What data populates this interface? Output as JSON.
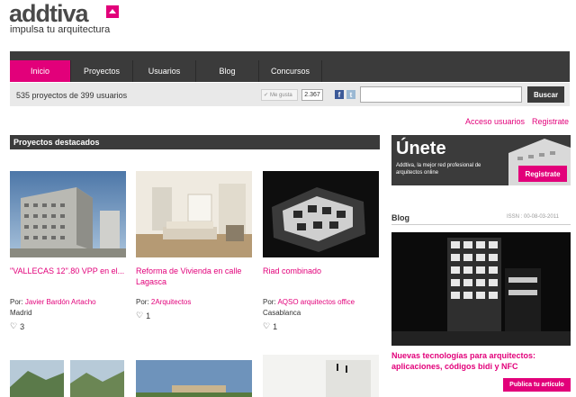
{
  "brand": {
    "name": "addtiva",
    "tagline": "impulsa tu arquitectura",
    "accent": "#e2007a",
    "dark": "#3b3b3b"
  },
  "nav": [
    {
      "label": "Inicio",
      "active": true
    },
    {
      "label": "Proyectos",
      "active": false
    },
    {
      "label": "Usuarios",
      "active": false
    },
    {
      "label": "Blog",
      "active": false
    },
    {
      "label": "Concursos",
      "active": false
    }
  ],
  "stats": "535 proyectos de 399 usuarios",
  "social": {
    "like_label": "Me gusta",
    "like_count": "2.367",
    "facebook_icon": "f",
    "twitter_icon": "t"
  },
  "search": {
    "placeholder": "",
    "button": "Buscar"
  },
  "account": {
    "login": "Acceso usuarios",
    "register": "Registrate"
  },
  "featured": {
    "header": "Proyectos destacados",
    "projects": [
      {
        "title": "\"VALLECAS 12\".80 VPP en el...",
        "by_label": "Por:",
        "author": "Javier Bardón Artacho",
        "location": "Madrid",
        "likes": "3"
      },
      {
        "title": "Reforma de Vivienda en calle Lagasca",
        "by_label": "Por:",
        "author": "2Arquitectos",
        "location": "",
        "likes": "1"
      },
      {
        "title": "Riad combinado",
        "by_label": "Por:",
        "author": "AQSO arquitectos office",
        "location": "Casablanca",
        "likes": "1"
      }
    ]
  },
  "join": {
    "title": "Únete",
    "subtitle": "Addtiva, la mejor red profesional de arquitectos online",
    "button": "Registrate"
  },
  "blog": {
    "title": "Blog",
    "isbn": "ISSN : 00-08-03-2011",
    "post_title": "Nuevas tecnologías para arquitectos: aplicaciones, códigos bidi y NFC",
    "publish_button": "Publica tu artículo"
  }
}
